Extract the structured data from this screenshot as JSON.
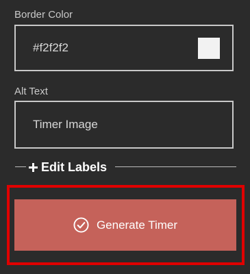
{
  "border_color": {
    "label": "Border Color",
    "value": "#f2f2f2",
    "swatch_color": "#f2f2f2"
  },
  "alt_text": {
    "label": "Alt Text",
    "value": "Timer Image"
  },
  "edit_labels": {
    "label": "Edit Labels",
    "icon": "plus-icon"
  },
  "generate": {
    "label": "Generate Timer",
    "icon": "check-circle-icon",
    "color": "#c5625a",
    "highlight_color": "#e00000"
  }
}
